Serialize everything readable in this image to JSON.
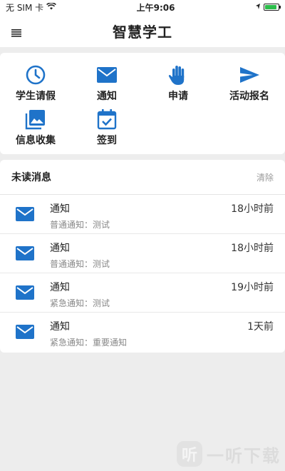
{
  "status_bar": {
    "carrier": "无 SIM 卡",
    "time": "上午9:06",
    "battery_level": 0.9
  },
  "header": {
    "title": "智慧学工",
    "menu_icon": "hamburger-menu-icon"
  },
  "features": [
    {
      "label": "学生请假",
      "icon": "clock-icon"
    },
    {
      "label": "通知",
      "icon": "mail-icon"
    },
    {
      "label": "申请",
      "icon": "hand-icon"
    },
    {
      "label": "活动报名",
      "icon": "send-icon"
    },
    {
      "label": "信息收集",
      "icon": "gallery-icon"
    },
    {
      "label": "签到",
      "icon": "calendar-check-icon"
    }
  ],
  "messages": {
    "title": "未读消息",
    "clear_label": "清除",
    "items": [
      {
        "name": "通知",
        "time": "18小时前",
        "preview": "普通通知：测试"
      },
      {
        "name": "通知",
        "time": "18小时前",
        "preview": "普通通知：测试"
      },
      {
        "name": "通知",
        "time": "19小时前",
        "preview": "紧急通知：测试"
      },
      {
        "name": "通知",
        "time": "1天前",
        "preview": "紧急通知：重要通知"
      }
    ]
  },
  "watermark": {
    "logo_char": "听",
    "text": "一听下载"
  },
  "colors": {
    "accent": "#1f73c9",
    "background": "#ededed",
    "battery": "#2bbd4a"
  }
}
